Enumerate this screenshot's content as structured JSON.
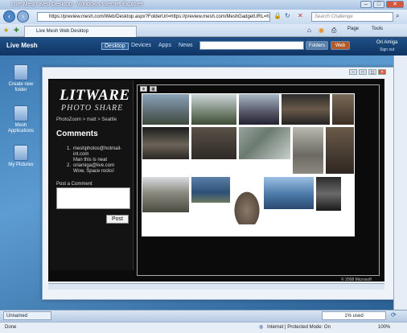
{
  "browser": {
    "window_title": "Live Mesh Web Desktop - Windows Internet Explorer",
    "url": "https://preview.mesh.com/Web/Desktop.aspx?FolderUrl=https://preview.mesh.com/MeshGadgetURL=h",
    "search_placeholder": "Search Challenge",
    "tab_label": "Live Mesh Web Desktop",
    "page_menu": "Page",
    "tools_menu": "Tools",
    "status_text": "Done",
    "zone_text": "Internet | Protected Mode: On",
    "zoom": "100%"
  },
  "mesh": {
    "logo": "Live Mesh",
    "nav": [
      "Desktop",
      "Devices",
      "Apps",
      "News"
    ],
    "folders_button": "Folders",
    "web_button": "Web",
    "user": "Ori Amiga",
    "signout": "Sign out"
  },
  "desktop_icons": [
    {
      "label": "Create new folder"
    },
    {
      "label": "Mesh Applications"
    },
    {
      "label": "My Pictures"
    }
  ],
  "app": {
    "logo_main": "LITWARE",
    "logo_sub": "PHOTO SHARE",
    "breadcrumb": "PhotoZoom > matt > Seattle",
    "comments_heading": "Comments",
    "comments": [
      {
        "num": "1.",
        "lines": [
          "meshphotos@hotmail-",
          "int.com",
          "Man this is neat"
        ]
      },
      {
        "num": "2.",
        "lines": [
          "oriamiga@live.com",
          "Wow, Space rocks!"
        ]
      }
    ],
    "post_label": "Post a Comment",
    "post_button": "Post",
    "copyright": "© 2008 Microsoft"
  },
  "taskbar": {
    "folder_name": "Unnamed",
    "used": "1% used"
  }
}
